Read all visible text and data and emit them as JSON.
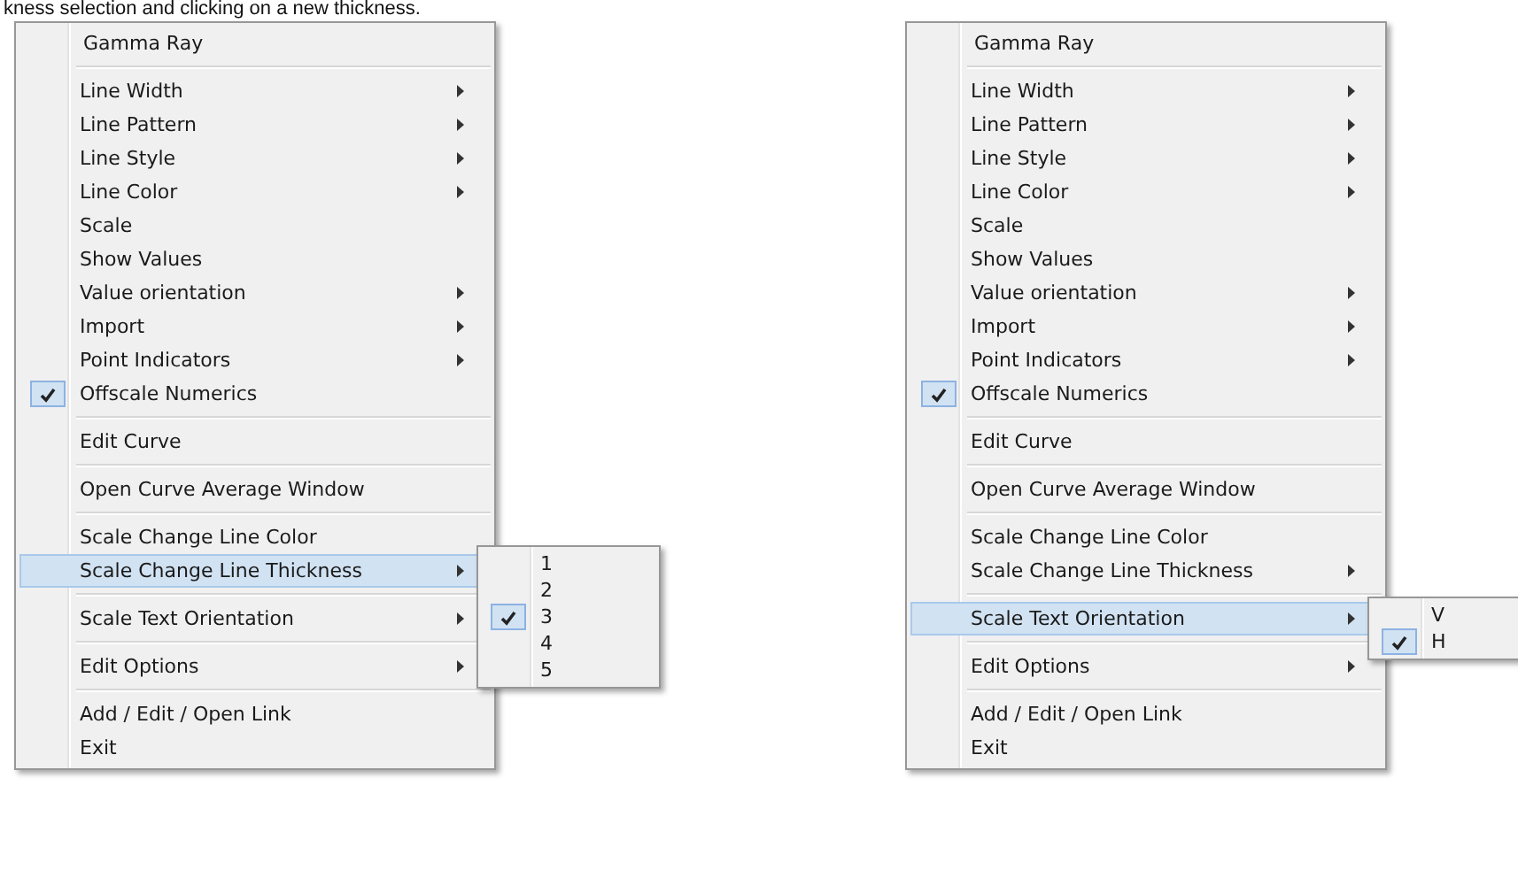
{
  "caption": "kness selection and clicking on a new thickness.",
  "menus": [
    {
      "items": [
        {
          "kind": "header",
          "label": "Gamma Ray"
        },
        {
          "kind": "separator"
        },
        {
          "kind": "item",
          "label": "Line Width",
          "submenu": true,
          "checked": false,
          "selected": false
        },
        {
          "kind": "item",
          "label": "Line Pattern",
          "submenu": true,
          "checked": false,
          "selected": false
        },
        {
          "kind": "item",
          "label": "Line Style",
          "submenu": true,
          "checked": false,
          "selected": false
        },
        {
          "kind": "item",
          "label": "Line Color",
          "submenu": true,
          "checked": false,
          "selected": false
        },
        {
          "kind": "item",
          "label": "Scale",
          "submenu": false,
          "checked": false,
          "selected": false
        },
        {
          "kind": "item",
          "label": "Show Values",
          "submenu": false,
          "checked": false,
          "selected": false
        },
        {
          "kind": "item",
          "label": "Value orientation",
          "submenu": true,
          "checked": false,
          "selected": false
        },
        {
          "kind": "item",
          "label": "Import",
          "submenu": true,
          "checked": false,
          "selected": false
        },
        {
          "kind": "item",
          "label": "Point Indicators",
          "submenu": true,
          "checked": false,
          "selected": false
        },
        {
          "kind": "item",
          "label": "Offscale Numerics",
          "submenu": false,
          "checked": true,
          "selected": false
        },
        {
          "kind": "separator"
        },
        {
          "kind": "item",
          "label": "Edit Curve",
          "submenu": false,
          "checked": false,
          "selected": false
        },
        {
          "kind": "separator"
        },
        {
          "kind": "item",
          "label": "Open Curve Average Window",
          "submenu": false,
          "checked": false,
          "selected": false
        },
        {
          "kind": "separator"
        },
        {
          "kind": "item",
          "label": "Scale Change Line Color",
          "submenu": false,
          "checked": false,
          "selected": false
        },
        {
          "kind": "item",
          "label": "Scale Change Line Thickness",
          "submenu": true,
          "checked": false,
          "selected": true,
          "items": [
            {
              "label": "1",
              "checked": false
            },
            {
              "label": "2",
              "checked": false
            },
            {
              "label": "3",
              "checked": true
            },
            {
              "label": "4",
              "checked": false
            },
            {
              "label": "5",
              "checked": false
            }
          ]
        },
        {
          "kind": "separator"
        },
        {
          "kind": "item",
          "label": "Scale Text Orientation",
          "submenu": true,
          "checked": false,
          "selected": false
        },
        {
          "kind": "separator"
        },
        {
          "kind": "item",
          "label": "Edit Options",
          "submenu": true,
          "checked": false,
          "selected": false
        },
        {
          "kind": "separator"
        },
        {
          "kind": "item",
          "label": "Add / Edit / Open Link",
          "submenu": false,
          "checked": false,
          "selected": false
        },
        {
          "kind": "item",
          "label": "Exit",
          "submenu": false,
          "checked": false,
          "selected": false
        }
      ]
    },
    {
      "items": [
        {
          "kind": "header",
          "label": "Gamma Ray"
        },
        {
          "kind": "separator"
        },
        {
          "kind": "item",
          "label": "Line Width",
          "submenu": true,
          "checked": false,
          "selected": false
        },
        {
          "kind": "item",
          "label": "Line Pattern",
          "submenu": true,
          "checked": false,
          "selected": false
        },
        {
          "kind": "item",
          "label": "Line Style",
          "submenu": true,
          "checked": false,
          "selected": false
        },
        {
          "kind": "item",
          "label": "Line Color",
          "submenu": true,
          "checked": false,
          "selected": false
        },
        {
          "kind": "item",
          "label": "Scale",
          "submenu": false,
          "checked": false,
          "selected": false
        },
        {
          "kind": "item",
          "label": "Show Values",
          "submenu": false,
          "checked": false,
          "selected": false
        },
        {
          "kind": "item",
          "label": "Value orientation",
          "submenu": true,
          "checked": false,
          "selected": false
        },
        {
          "kind": "item",
          "label": "Import",
          "submenu": true,
          "checked": false,
          "selected": false
        },
        {
          "kind": "item",
          "label": "Point Indicators",
          "submenu": true,
          "checked": false,
          "selected": false
        },
        {
          "kind": "item",
          "label": "Offscale Numerics",
          "submenu": false,
          "checked": true,
          "selected": false
        },
        {
          "kind": "separator"
        },
        {
          "kind": "item",
          "label": "Edit Curve",
          "submenu": false,
          "checked": false,
          "selected": false
        },
        {
          "kind": "separator"
        },
        {
          "kind": "item",
          "label": "Open Curve Average Window",
          "submenu": false,
          "checked": false,
          "selected": false
        },
        {
          "kind": "separator"
        },
        {
          "kind": "item",
          "label": "Scale Change Line Color",
          "submenu": false,
          "checked": false,
          "selected": false
        },
        {
          "kind": "item",
          "label": "Scale Change Line Thickness",
          "submenu": true,
          "checked": false,
          "selected": false
        },
        {
          "kind": "separator"
        },
        {
          "kind": "item",
          "label": "Scale Text Orientation",
          "submenu": true,
          "checked": false,
          "selected": true,
          "items": [
            {
              "label": "V",
              "checked": false
            },
            {
              "label": "H",
              "checked": true
            }
          ]
        },
        {
          "kind": "separator"
        },
        {
          "kind": "item",
          "label": "Edit Options",
          "submenu": true,
          "checked": false,
          "selected": false
        },
        {
          "kind": "separator"
        },
        {
          "kind": "item",
          "label": "Add / Edit / Open Link",
          "submenu": false,
          "checked": false,
          "selected": false
        },
        {
          "kind": "item",
          "label": "Exit",
          "submenu": false,
          "checked": false,
          "selected": false
        }
      ]
    }
  ]
}
